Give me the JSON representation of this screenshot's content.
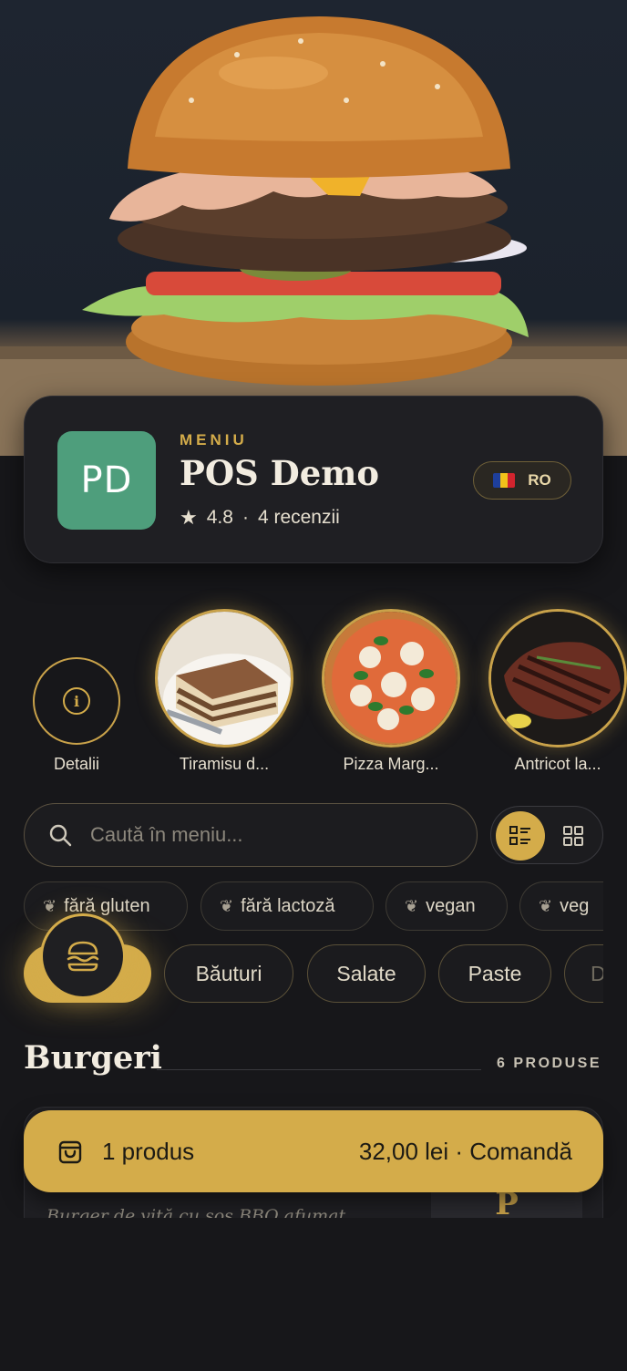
{
  "header": {
    "eyebrow": "MENIU",
    "title": "POS Demo",
    "logo_initials": "PD",
    "rating": "4.8",
    "separator": "·",
    "reviews": "4 recenzii",
    "language": "RO"
  },
  "stories": [
    {
      "label": "Detalii",
      "icon": "info-icon"
    },
    {
      "label": "Tiramisu d...",
      "image": "tiramisu"
    },
    {
      "label": "Pizza Marg...",
      "image": "pizza"
    },
    {
      "label": "Antricot la...",
      "image": "steak"
    }
  ],
  "search": {
    "placeholder": "Caută în meniu..."
  },
  "view_modes": {
    "active": "list",
    "options": [
      "list",
      "grid"
    ]
  },
  "diet_filters": [
    {
      "label": "fără gluten",
      "icon": "leaf-icon"
    },
    {
      "label": "fără lactoză",
      "icon": "leaf-icon"
    },
    {
      "label": "vegan",
      "icon": "leaf-icon"
    },
    {
      "label": "veg",
      "icon": "leaf-icon"
    }
  ],
  "categories": [
    {
      "label": "",
      "icon": "burger-icon",
      "active": true
    },
    {
      "label": "Băuturi"
    },
    {
      "label": "Salate"
    },
    {
      "label": "Paste"
    },
    {
      "label": "D"
    }
  ],
  "section": {
    "title": "Burgeri",
    "count": "6 PRODUSE"
  },
  "product_preview": {
    "description": "Burger de vită cu sos BBQ afumat",
    "thumb_letter": "P"
  },
  "cart": {
    "count_label": "1 produs",
    "total_label": "32,00 lei · Comandă"
  },
  "colors": {
    "accent": "#d4ac4a",
    "logo_bg": "#4e9e7c",
    "background": "#17171a",
    "card": "#1f1f23"
  }
}
